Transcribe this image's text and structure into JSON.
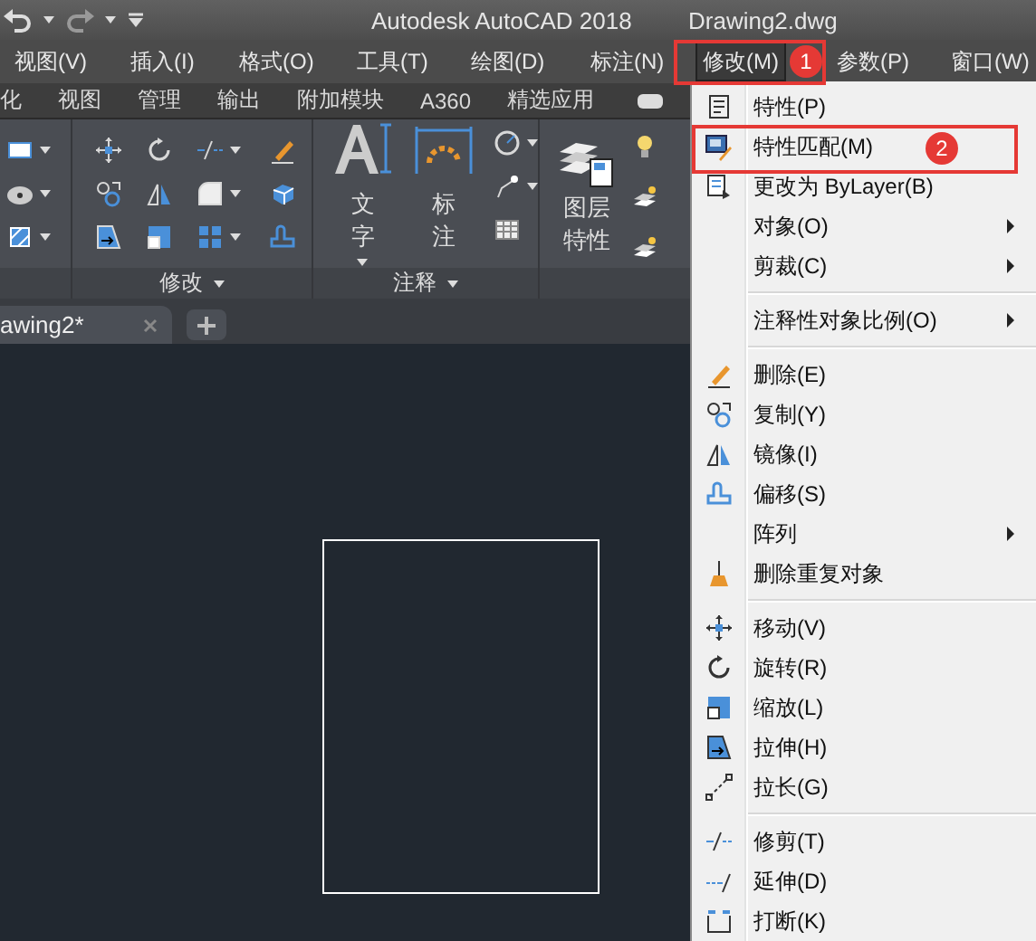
{
  "title_bar": {
    "title": "Autodesk AutoCAD 2018",
    "document": "Drawing2.dwg"
  },
  "menu_bar": [
    {
      "label": "视图(V)",
      "selected": false
    },
    {
      "label": "插入(I)",
      "selected": false
    },
    {
      "label": "格式(O)",
      "selected": false
    },
    {
      "label": "工具(T)",
      "selected": false
    },
    {
      "label": "绘图(D)",
      "selected": false
    },
    {
      "label": "标注(N)",
      "selected": false
    },
    {
      "label": "修改(M)",
      "selected": true
    },
    {
      "label": "参数(P)",
      "selected": false
    },
    {
      "label": "窗口(W)",
      "selected": false
    }
  ],
  "ribbon_tabs": [
    {
      "label": "化"
    },
    {
      "label": "视图"
    },
    {
      "label": "管理"
    },
    {
      "label": "输出"
    },
    {
      "label": "附加模块"
    },
    {
      "label": "A360"
    },
    {
      "label": "精选应用"
    }
  ],
  "ribbon": {
    "panels": [
      {
        "label": "修改"
      },
      {
        "label": "注释"
      }
    ],
    "buttons": [
      {
        "label": "文字"
      },
      {
        "label": "标注"
      },
      {
        "label": "图层特性"
      }
    ]
  },
  "document_tabs": [
    {
      "label": "awing2*"
    }
  ],
  "context_menu": {
    "items": [
      {
        "kind": "item",
        "label": "特性(P)",
        "submenu": false
      },
      {
        "kind": "item",
        "label": "特性匹配(M)",
        "submenu": false
      },
      {
        "kind": "item",
        "label": "更改为 ByLayer(B)",
        "submenu": false
      },
      {
        "kind": "item",
        "label": "对象(O)",
        "submenu": true
      },
      {
        "kind": "item",
        "label": "剪裁(C)",
        "submenu": true
      },
      {
        "kind": "separator"
      },
      {
        "kind": "item",
        "label": "注释性对象比例(O)",
        "submenu": true
      },
      {
        "kind": "separator"
      },
      {
        "kind": "item",
        "label": "删除(E)",
        "submenu": false
      },
      {
        "kind": "item",
        "label": "复制(Y)",
        "submenu": false
      },
      {
        "kind": "item",
        "label": "镜像(I)",
        "submenu": false
      },
      {
        "kind": "item",
        "label": "偏移(S)",
        "submenu": false
      },
      {
        "kind": "item",
        "label": "阵列",
        "submenu": true
      },
      {
        "kind": "item",
        "label": "删除重复对象",
        "submenu": false
      },
      {
        "kind": "separator"
      },
      {
        "kind": "item",
        "label": "移动(V)",
        "submenu": false
      },
      {
        "kind": "item",
        "label": "旋转(R)",
        "submenu": false
      },
      {
        "kind": "item",
        "label": "缩放(L)",
        "submenu": false
      },
      {
        "kind": "item",
        "label": "拉伸(H)",
        "submenu": false
      },
      {
        "kind": "item",
        "label": "拉长(G)",
        "submenu": false
      },
      {
        "kind": "separator"
      },
      {
        "kind": "item",
        "label": "修剪(T)",
        "submenu": false
      },
      {
        "kind": "item",
        "label": "延伸(D)",
        "submenu": false
      },
      {
        "kind": "item",
        "label": "打断(K)",
        "submenu": false
      }
    ]
  },
  "annotations": [
    {
      "label": "1"
    },
    {
      "label": "2"
    }
  ]
}
